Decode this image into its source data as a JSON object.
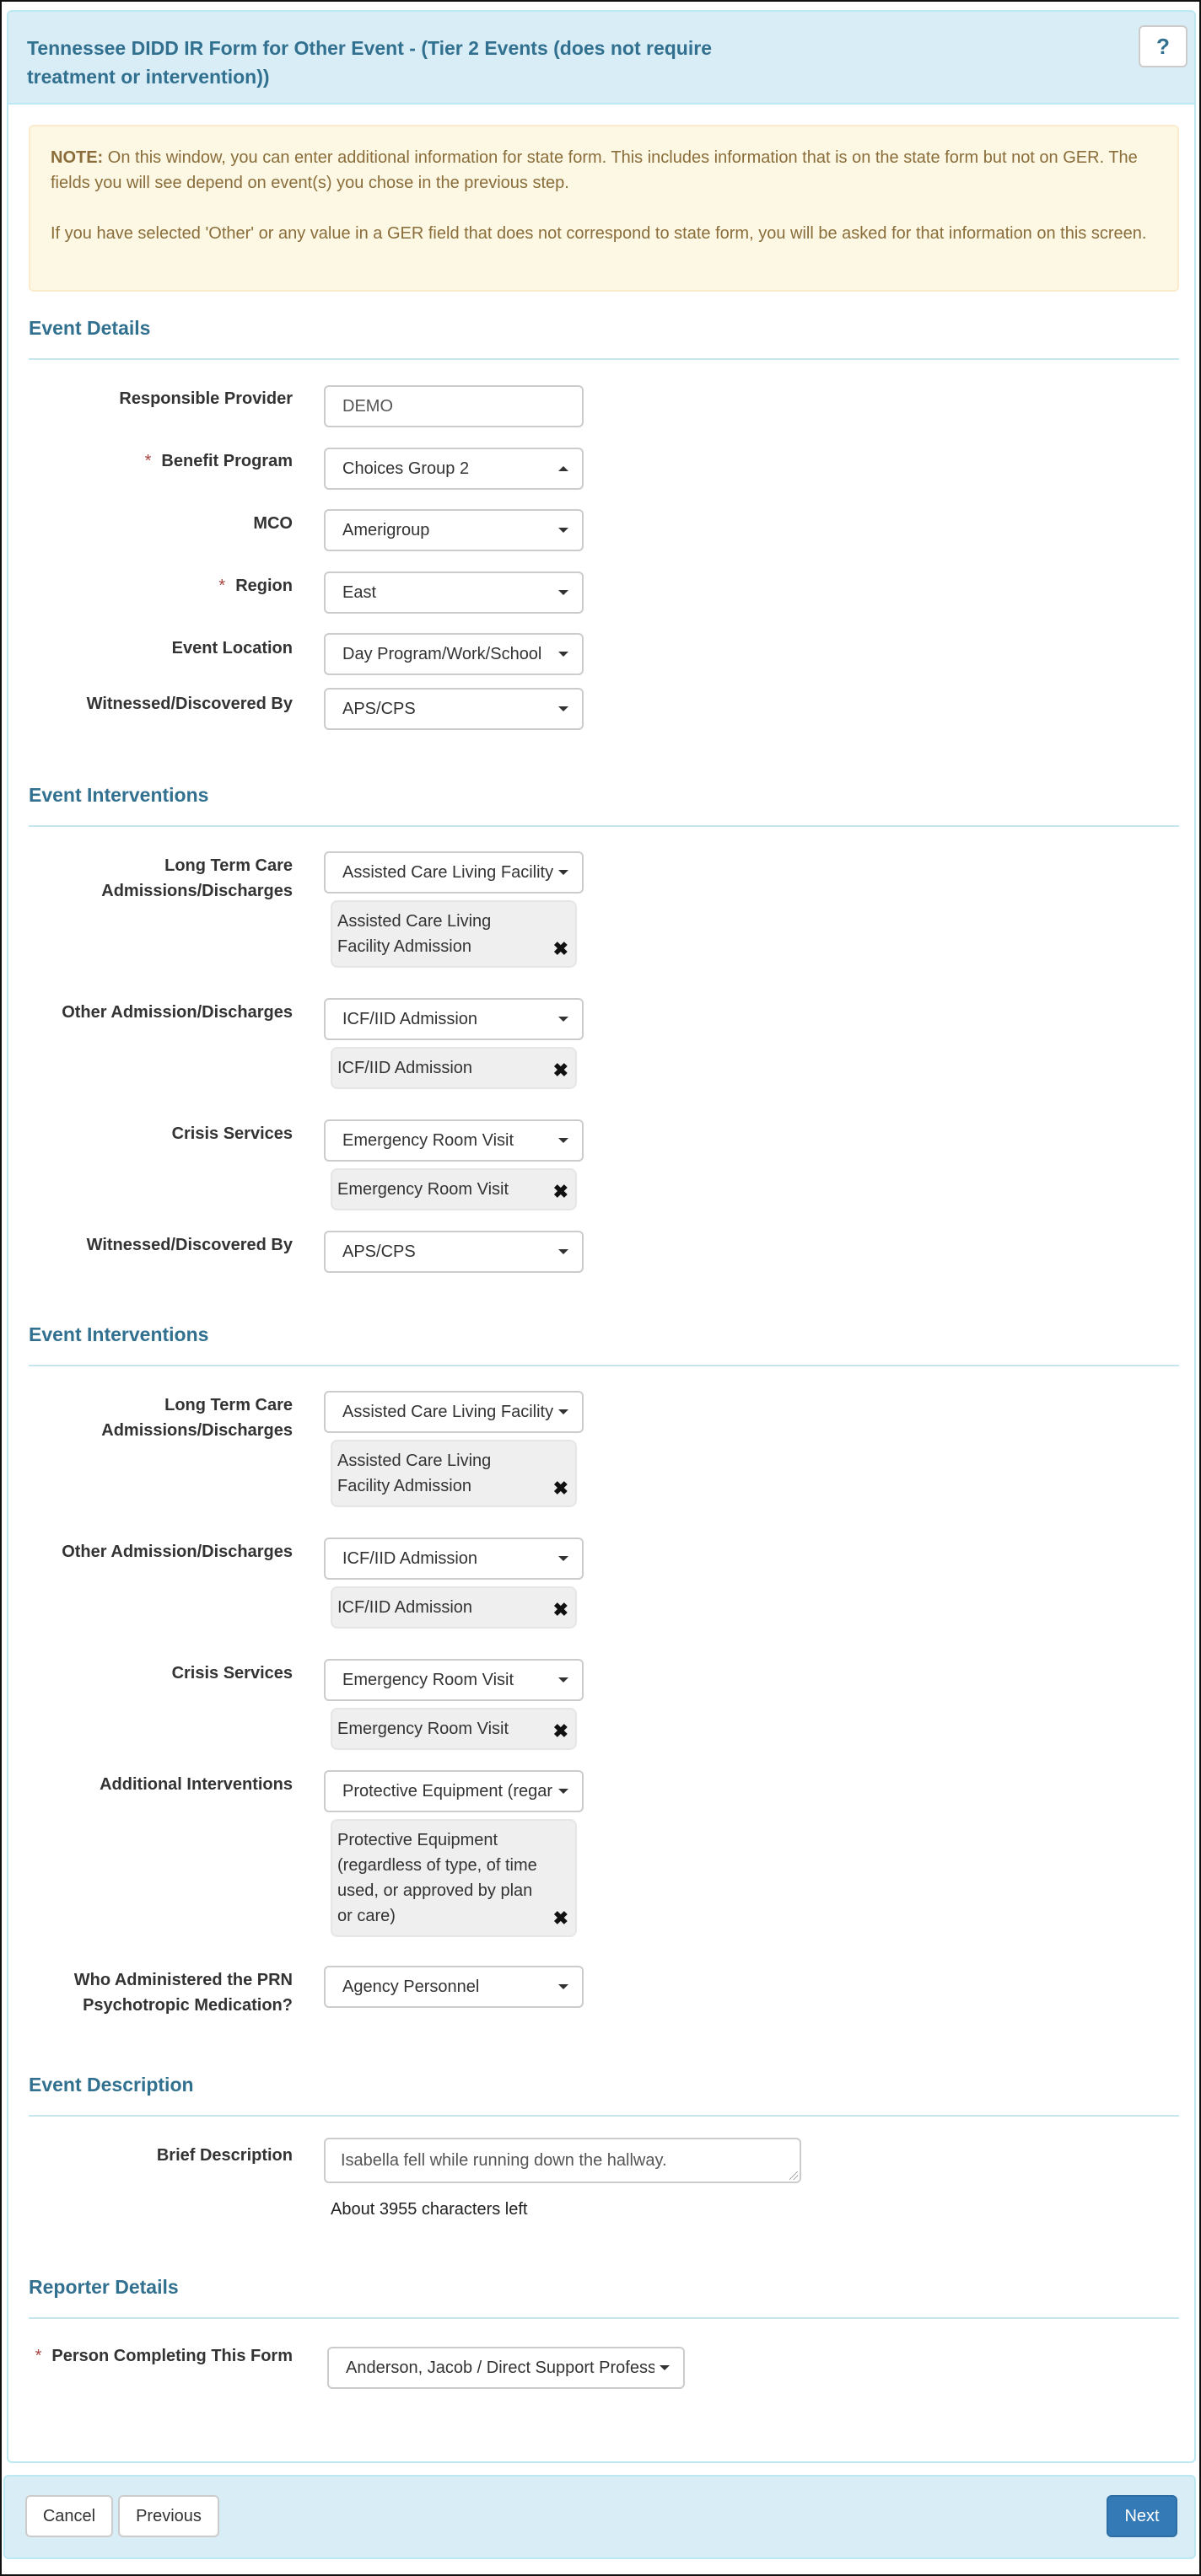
{
  "header": {
    "title": "Tennessee DIDD IR Form for Other Event - (Tier 2 Events (does not require treatment or intervention))",
    "help_label": "?"
  },
  "note": {
    "prefix": "NOTE:",
    "text1": " On this window, you can enter additional information for state form. This includes information that is on the state form but not on GER. The fields you will see depend on event(s) you chose in the previous step.",
    "text2": "If you have selected 'Other' or any value in a GER field that does not correspond to state form, you will be asked for that information on this screen."
  },
  "required_marker": "*",
  "remove_icon": "✖",
  "event_details": {
    "title": "Event Details",
    "responsible_provider": {
      "label": "Responsible Provider",
      "value": "DEMO"
    },
    "benefit_program": {
      "label": "Benefit Program",
      "value": "Choices Group 2",
      "required": true
    },
    "mco": {
      "label": "MCO",
      "value": "Amerigroup"
    },
    "region": {
      "label": "Region",
      "value": "East",
      "required": true
    },
    "event_location": {
      "label": "Event Location",
      "value": "Day Program/Work/School"
    },
    "witnessed_by": {
      "label": "Witnessed/Discovered By",
      "value": "APS/CPS"
    }
  },
  "event_interventions_1": {
    "title": "Event Interventions",
    "long_term_care": {
      "label": "Long Term Care Admissions/Discharges",
      "value": "Assisted Care Living Facility Admission",
      "tags": [
        "Assisted Care Living Facility Admission"
      ]
    },
    "other_admission": {
      "label": "Other Admission/Discharges",
      "value": "ICF/IID Admission",
      "tags": [
        "ICF/IID Admission"
      ]
    },
    "crisis_services": {
      "label": "Crisis Services",
      "value": "Emergency Room Visit",
      "tags": [
        "Emergency Room Visit"
      ]
    },
    "witnessed_by": {
      "label": "Witnessed/Discovered By",
      "value": "APS/CPS"
    }
  },
  "event_interventions_2": {
    "title": "Event Interventions",
    "long_term_care": {
      "label": "Long Term Care Admissions/Discharges",
      "value": "Assisted Care Living Facility Admission",
      "tags": [
        "Assisted Care Living Facility Admission"
      ]
    },
    "other_admission": {
      "label": "Other Admission/Discharges",
      "value": "ICF/IID Admission",
      "tags": [
        "ICF/IID Admission"
      ]
    },
    "crisis_services": {
      "label": "Crisis Services",
      "value": "Emergency Room Visit",
      "tags": [
        "Emergency Room Visit"
      ]
    },
    "additional_interventions": {
      "label": "Additional Interventions",
      "value": "Protective Equipment (regardless of type, of time used, or approved by plan or care)",
      "tags": [
        "Protective Equipment (regardless of type, of time used, or approved by plan or care)"
      ]
    },
    "prn_administered_by": {
      "label": "Who Administered the PRN Psychotropic Medication?",
      "value": "Agency Personnel"
    }
  },
  "event_description": {
    "title": "Event Description",
    "brief_description": {
      "label": "Brief Description",
      "value": "Isabella fell while running down the hallway."
    },
    "chars_left": "About 3955 characters left"
  },
  "reporter_details": {
    "title": "Reporter Details",
    "person_completing": {
      "label": "Person Completing This Form",
      "value": "Anderson, Jacob / Direct Support Professional",
      "required": true
    }
  },
  "footer": {
    "cancel_label": "Cancel",
    "previous_label": "Previous",
    "next_label": "Next"
  },
  "colors": {
    "heading_bg": "#d9edf7",
    "heading_text": "#31708f",
    "note_bg": "#fcf8e3",
    "note_text": "#8a6d3b",
    "required": "#a94442",
    "primary": "#337ab7"
  }
}
